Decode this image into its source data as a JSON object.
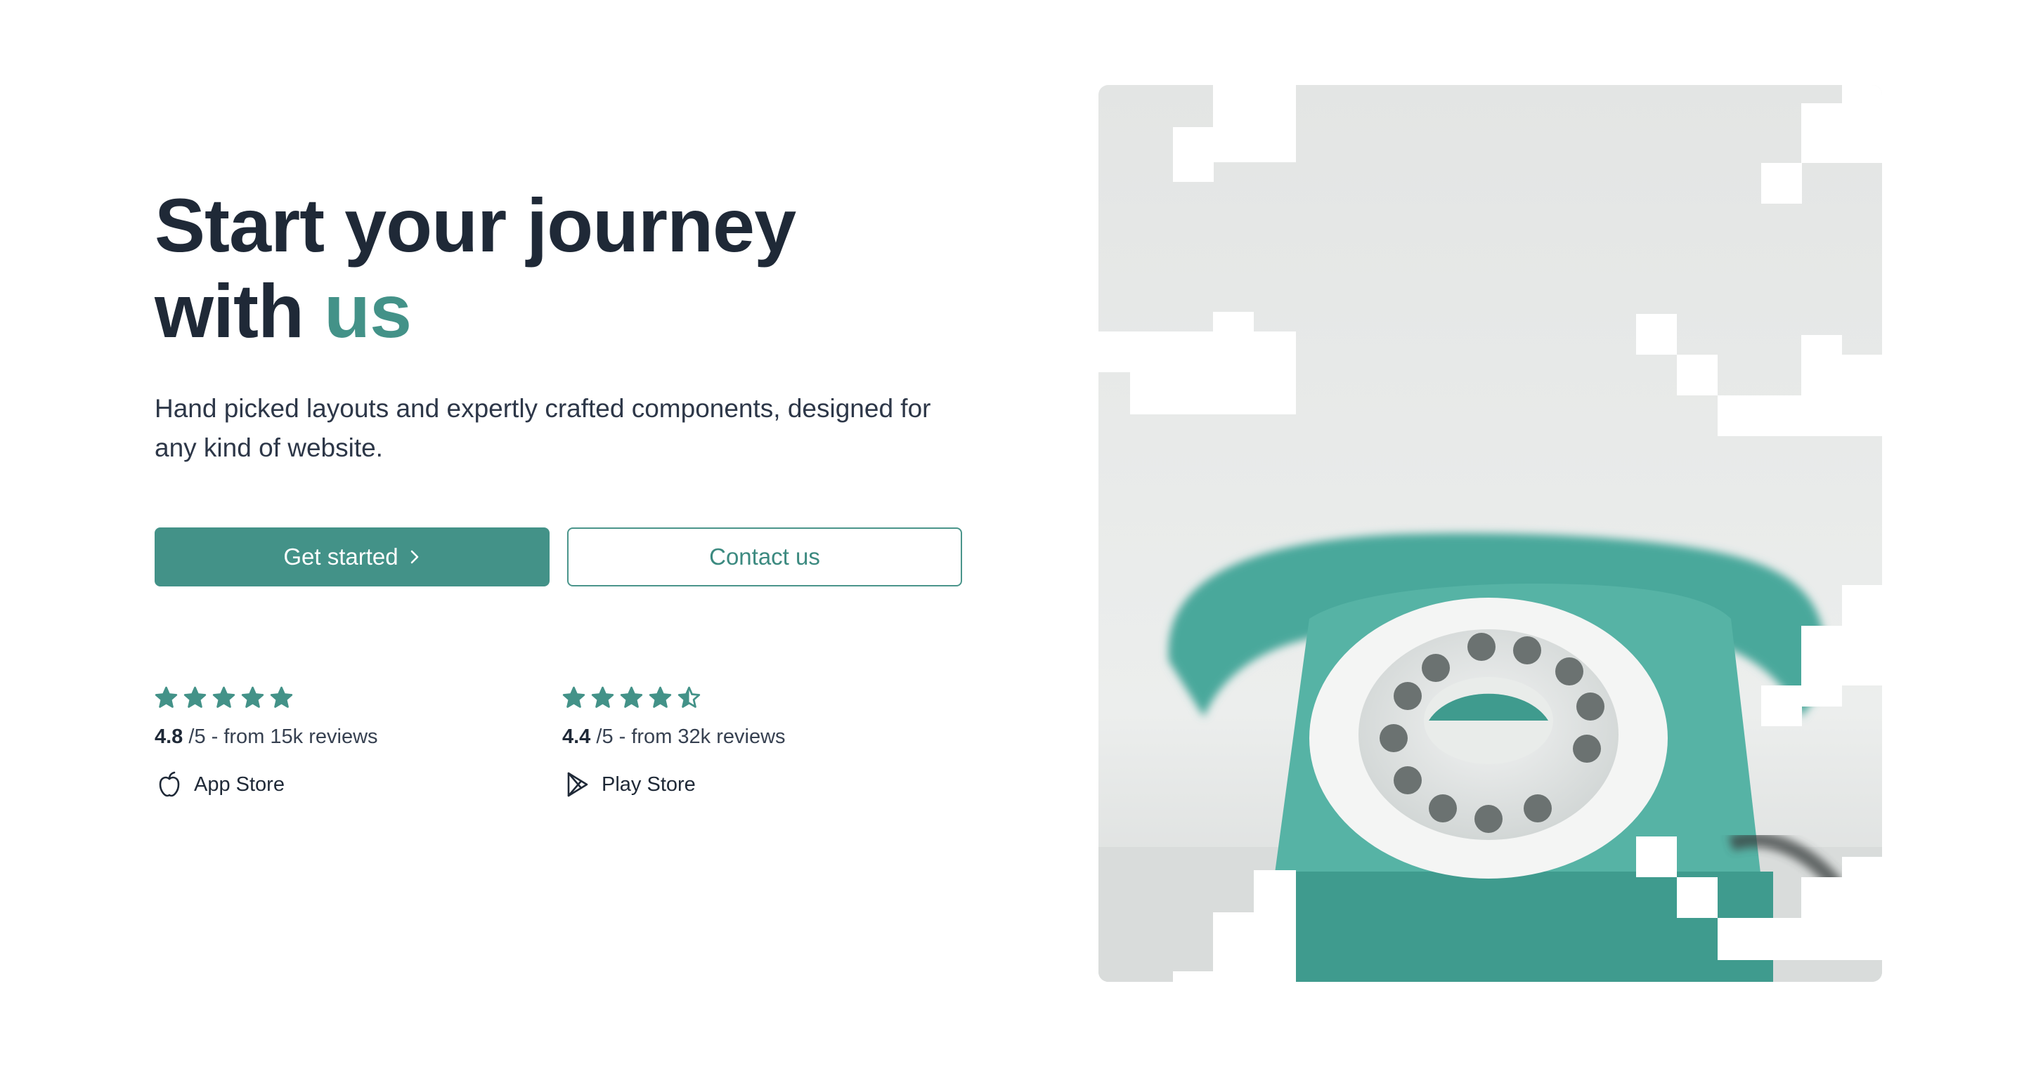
{
  "hero": {
    "title_line1": "Start your journey",
    "title_line2_prefix": "with",
    "title_line2_accent": "us",
    "subtitle": "Hand picked layouts and expertly crafted components, designed for any kind of website."
  },
  "actions": {
    "primary_label": "Get started",
    "secondary_label": "Contact us"
  },
  "ratings": [
    {
      "stars": 5,
      "score": "4.8",
      "suffix": "/5 - from 15k reviews",
      "store": "App Store",
      "icon": "apple-icon"
    },
    {
      "stars": 4.5,
      "score": "4.4",
      "suffix": "/5 - from 32k reviews",
      "store": "Play Store",
      "icon": "play-store-icon"
    }
  ],
  "image": {
    "subject": "telephone-photo"
  },
  "colors": {
    "accent": "#439288",
    "heading": "#1f2937",
    "text": "#2d3748",
    "telephone": "#4aa89b"
  }
}
